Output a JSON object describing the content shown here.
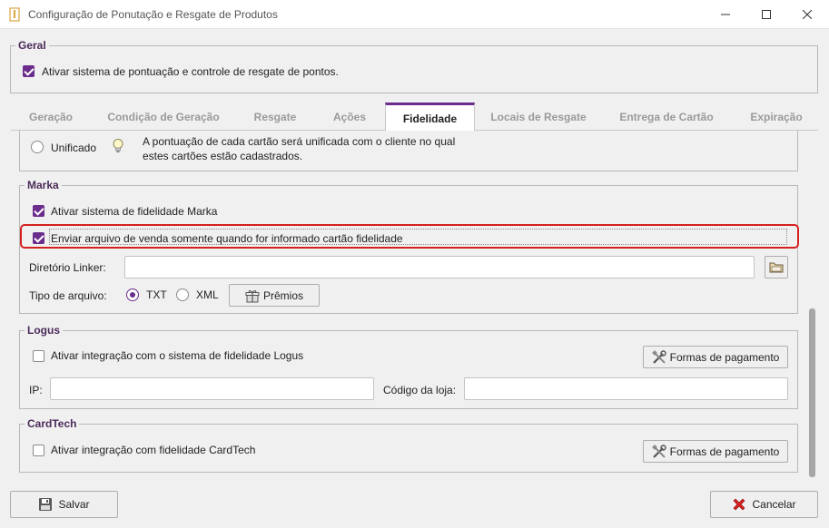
{
  "window": {
    "title": "Configuração de Ponutação e Resgate de Produtos",
    "controls": {
      "minimize": "minimize-icon",
      "maximize": "maximize-icon",
      "close": "close-icon"
    }
  },
  "geral": {
    "title": "Geral",
    "enable_label": "Ativar sistema de pontuação e controle de resgate de pontos.",
    "enable_checked": true
  },
  "tabs": [
    {
      "label": "Geração",
      "active": false
    },
    {
      "label": "Condição de Geração",
      "active": false
    },
    {
      "label": "Resgate",
      "active": false
    },
    {
      "label": "Ações",
      "active": false
    },
    {
      "label": "Fidelidade",
      "active": true
    },
    {
      "label": "Locais de Resgate",
      "active": false
    },
    {
      "label": "Entrega de Cartão",
      "active": false
    },
    {
      "label": "Expiração",
      "active": false
    }
  ],
  "unificado": {
    "label": "Unificado",
    "selected": false,
    "hint_icon": "lightbulb-icon",
    "hint_line1": "A pontuação de cada cartão será unificada com o cliente no qual",
    "hint_line2": "estes cartões estão cadastrados."
  },
  "marka": {
    "title": "Marka",
    "enable_label": "Ativar sistema de fidelidade Marka",
    "enable_checked": true,
    "send_label": "Enviar arquivo de venda somente quando for informado cartão fidelidade",
    "send_checked": true,
    "dir_label": "Diretório Linker:",
    "dir_value": "",
    "folder_icon": "folder-icon",
    "file_type_label": "Tipo de arquivo:",
    "txt_label": "TXT",
    "txt_selected": true,
    "xml_label": "XML",
    "xml_selected": false,
    "premios_label": "Prêmios",
    "premios_icon": "gift-icon"
  },
  "logus": {
    "title": "Logus",
    "enable_label": "Ativar integração com o sistema de fidelidade Logus",
    "enable_checked": false,
    "payment_label": "Formas de pagamento",
    "payment_icon": "tools-icon",
    "ip_label": "IP:",
    "ip_value": "",
    "store_label": "Código da loja:",
    "store_value": ""
  },
  "cardtech": {
    "title": "CardTech",
    "enable_label": "Ativar integração com fidelidade CardTech",
    "enable_checked": false,
    "payment_label": "Formas de pagamento",
    "payment_icon": "tools-icon"
  },
  "footer": {
    "save_label": "Salvar",
    "save_icon": "floppy-disk-icon",
    "cancel_label": "Cancelar",
    "cancel_icon": "red-x-icon"
  },
  "colors": {
    "accent": "#6b2d8c",
    "highlight": "#d62020"
  }
}
